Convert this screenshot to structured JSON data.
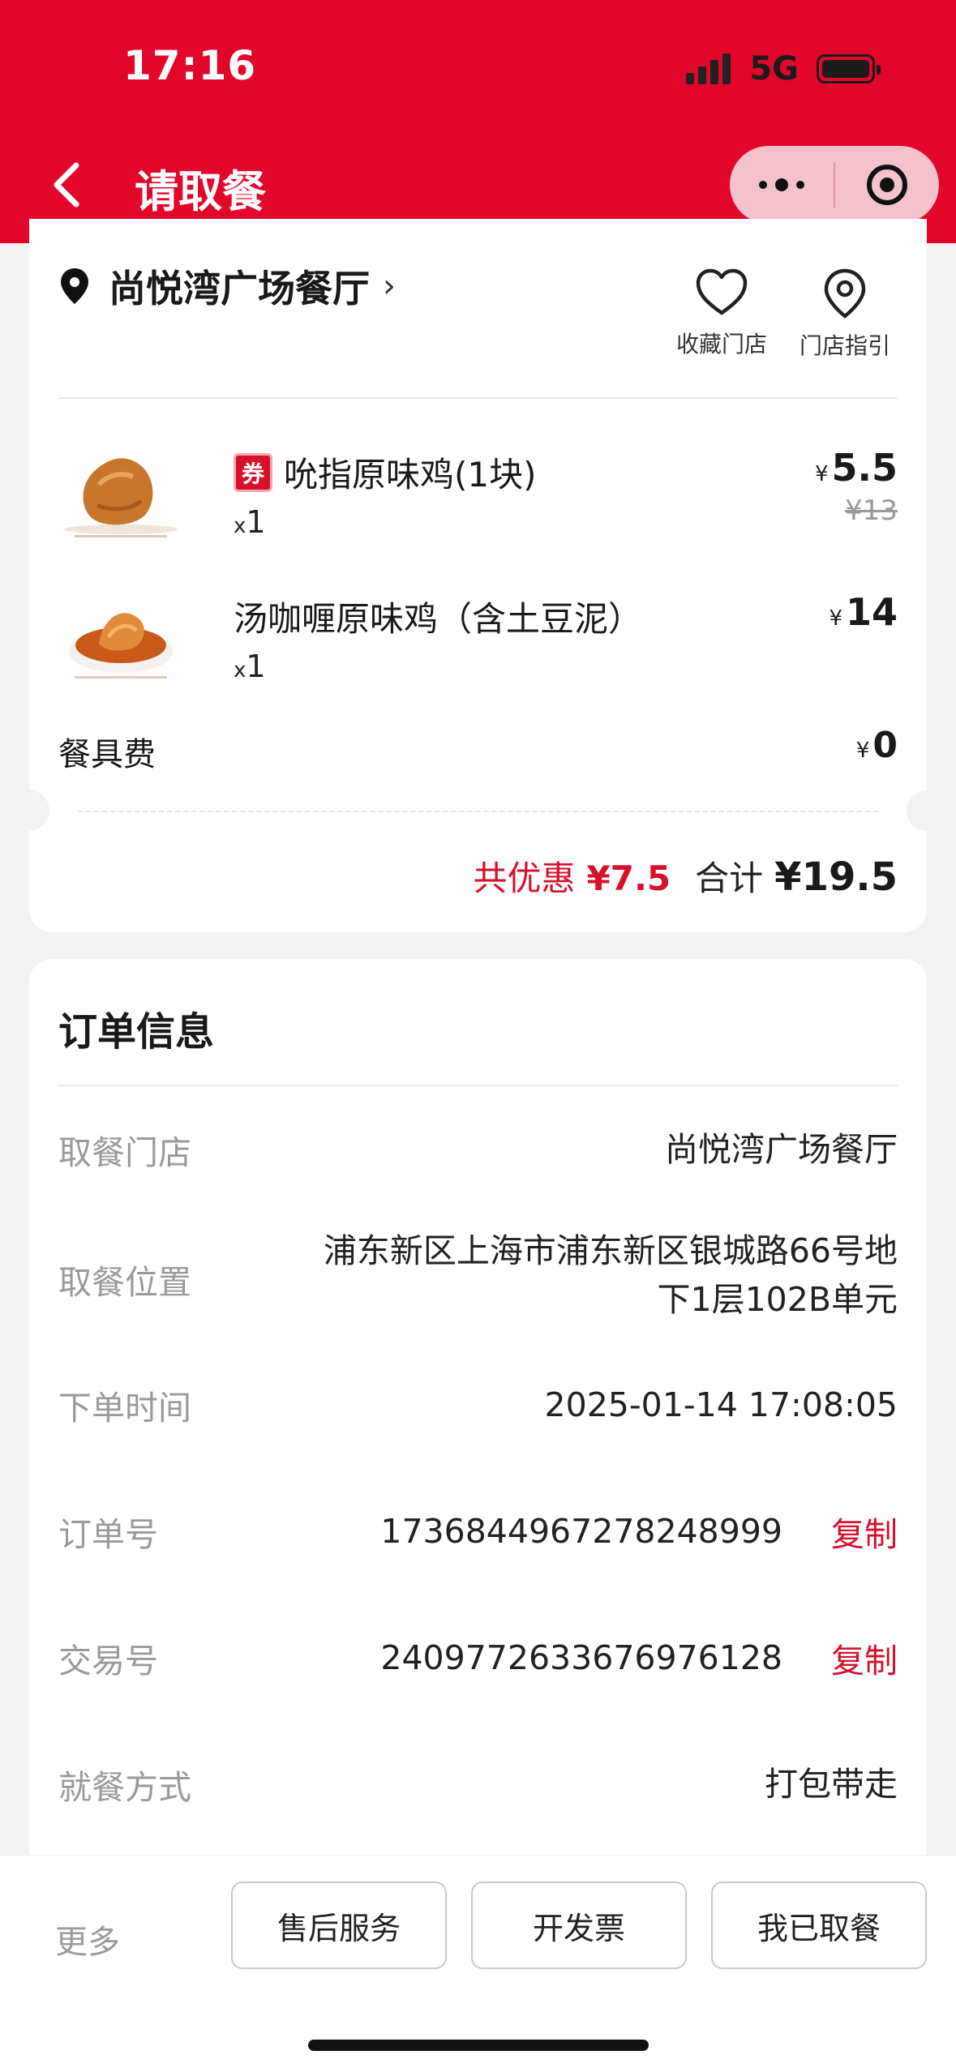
{
  "status_bar": {
    "time": "17:16",
    "network": "5G"
  },
  "nav": {
    "title": "请取餐"
  },
  "store": {
    "name": "尚悦湾广场餐厅",
    "favorite_label": "收藏门店",
    "guide_label": "门店指引"
  },
  "items": [
    {
      "name": "吮指原味鸡(1块)",
      "coupon_badge": "券",
      "qty_prefix": "x",
      "qty": "1",
      "currency": "¥",
      "price": "5.5",
      "original_price": "¥13"
    },
    {
      "name": "汤咖喱原味鸡（含土豆泥）",
      "qty_prefix": "x",
      "qty": "1",
      "currency": "¥",
      "price": "14"
    }
  ],
  "tableware": {
    "label": "餐具费",
    "currency": "¥",
    "value": "0"
  },
  "totals": {
    "discount_label": "共优惠",
    "discount_value": "¥7.5",
    "sum_label": "合计",
    "sum_value": "¥19.5"
  },
  "order_info": {
    "title": "订单信息",
    "rows": [
      {
        "label": "取餐门店",
        "value": "尚悦湾广场餐厅"
      },
      {
        "label": "取餐位置",
        "value_line1": "浦东新区上海市浦东新区银城路66号地",
        "value_line2": "下1层102B单元"
      },
      {
        "label": "下单时间",
        "value": "2025-01-14 17:08:05"
      },
      {
        "label": "订单号",
        "value": "1736844967278248999",
        "action": "复制"
      },
      {
        "label": "交易号",
        "value": "2409772633676976128",
        "action": "复制"
      },
      {
        "label": "就餐方式",
        "value": "打包带走"
      }
    ]
  },
  "bottom_bar": {
    "more": "更多",
    "buttons": [
      "售后服务",
      "开发票",
      "我已取餐"
    ]
  },
  "colors": {
    "brand_red": "#e3062b",
    "accent_red": "#d6112c"
  }
}
